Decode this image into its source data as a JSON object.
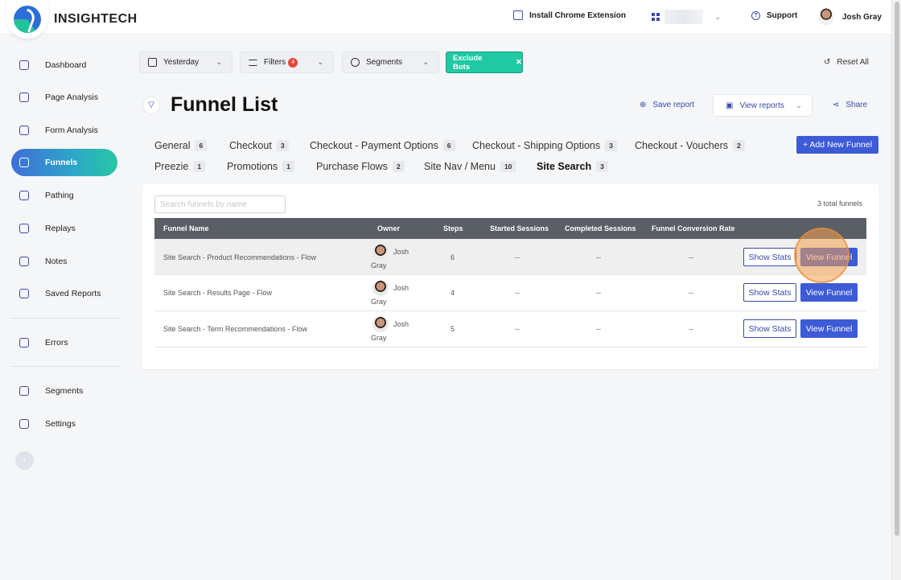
{
  "header": {
    "brand": "INSIGHTECH",
    "install_extension": "Install Chrome Extension",
    "support": "Support",
    "user_name": "Josh Gray"
  },
  "sidebar": {
    "items": [
      {
        "label": "Dashboard",
        "icon": "dashboard-icon"
      },
      {
        "label": "Page Analysis",
        "icon": "page-analysis-icon"
      },
      {
        "label": "Form Analysis",
        "icon": "form-analysis-icon"
      },
      {
        "label": "Funnels",
        "icon": "funnel-icon",
        "active": true
      },
      {
        "label": "Pathing",
        "icon": "pathing-icon"
      },
      {
        "label": "Replays",
        "icon": "replays-icon"
      },
      {
        "label": "Notes",
        "icon": "notes-icon"
      },
      {
        "label": "Saved Reports",
        "icon": "saved-reports-icon"
      },
      {
        "label": "Errors",
        "icon": "bug-icon"
      },
      {
        "label": "Segments",
        "icon": "segments-icon"
      },
      {
        "label": "Settings",
        "icon": "settings-icon"
      }
    ],
    "collapse": "‹"
  },
  "filters": {
    "date": "Yesterday",
    "filters_label": "Filters",
    "filters_count": "4",
    "segments": "Segments",
    "exclude_bots": "Exclude Bots",
    "exclude_bots_close": "✕",
    "reset_all": "Reset All"
  },
  "page": {
    "title": "Funnel List",
    "save_report": "Save report",
    "view_reports": "View reports",
    "share": "Share",
    "add_new_funnel": "+ Add New Funnel"
  },
  "tabs": [
    {
      "label": "General",
      "count": "6"
    },
    {
      "label": "Checkout",
      "count": "3"
    },
    {
      "label": "Checkout - Payment Options",
      "count": "6"
    },
    {
      "label": "Checkout - Shipping Options",
      "count": "3"
    },
    {
      "label": "Checkout - Vouchers",
      "count": "2"
    },
    {
      "label": "Preezie",
      "count": "1"
    },
    {
      "label": "Promotions",
      "count": "1"
    },
    {
      "label": "Purchase Flows",
      "count": "2"
    },
    {
      "label": "Site Nav / Menu",
      "count": "10"
    },
    {
      "label": "Site Search",
      "count": "3",
      "active": true
    }
  ],
  "table": {
    "search_placeholder": "Search funnels by name",
    "total": "3 total funnels",
    "columns": [
      "Funnel Name",
      "Owner",
      "Steps",
      "Started Sessions",
      "Completed Sessions",
      "Funnel Conversion Rate"
    ],
    "rows": [
      {
        "name": "Site Search - Product Recommendations - Flow",
        "owner_first": "Josh",
        "owner_last": "Gray",
        "steps": "6",
        "started": "--",
        "completed": "--",
        "rate": "--"
      },
      {
        "name": "Site Search - Results Page - Flow",
        "owner_first": "Josh",
        "owner_last": "Gray",
        "steps": "4",
        "started": "--",
        "completed": "--",
        "rate": "--"
      },
      {
        "name": "Site Search - Term Recommendations - Flow",
        "owner_first": "Josh",
        "owner_last": "Gray",
        "steps": "5",
        "started": "--",
        "completed": "--",
        "rate": "--"
      }
    ],
    "show_stats": "Show Stats",
    "view_funnel": "View Funnel"
  }
}
